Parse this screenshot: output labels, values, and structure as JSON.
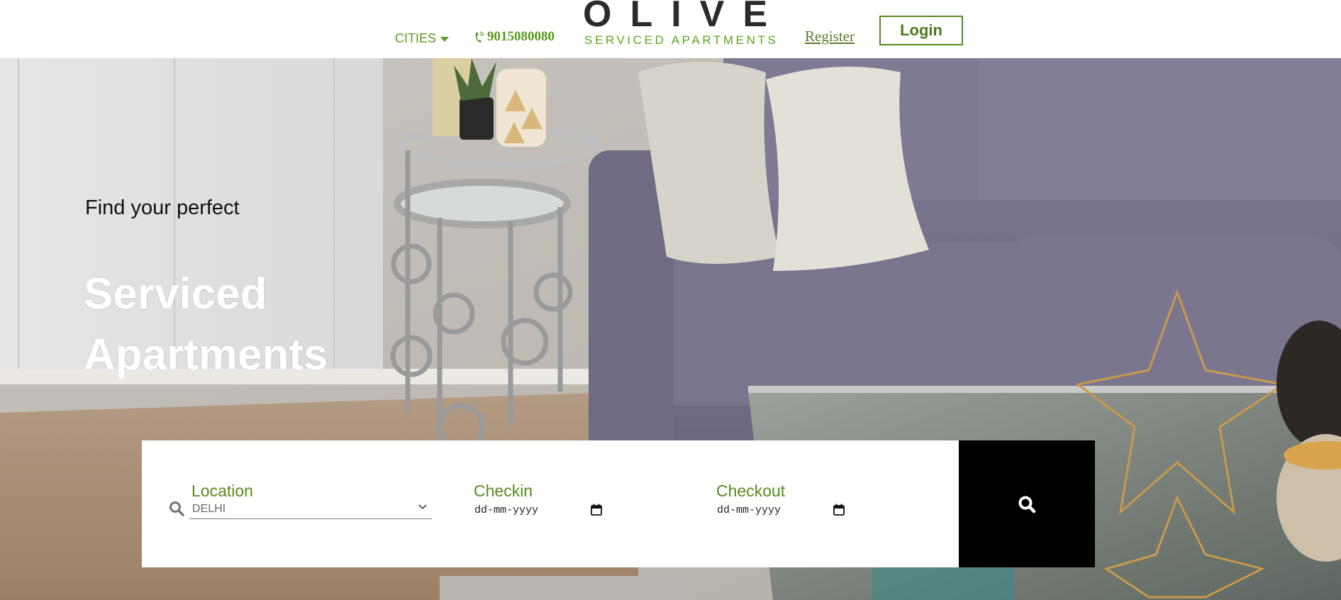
{
  "header": {
    "cities_label": "CITIES",
    "phone": "9015080080",
    "logo_main": "OLIVE",
    "logo_sub": "SERVICED APARTMENTS",
    "register_label": "Register",
    "login_label": "Login"
  },
  "hero": {
    "kicker": "Find your perfect",
    "title_line1": "Serviced",
    "title_line2": "Apartments"
  },
  "search": {
    "location_label": "Location",
    "location_value": "DELHI",
    "checkin_label": "Checkin",
    "checkin_placeholder": "dd-mm-yyyy",
    "checkout_label": "Checkout",
    "checkout_placeholder": "dd-mm-yyyy"
  },
  "colors": {
    "brand_green": "#5a9a1e",
    "search_button": "#000000"
  },
  "icons": [
    "caret-down-icon",
    "phone-icon",
    "search-icon",
    "chevron-down-icon",
    "calendar-icon"
  ]
}
